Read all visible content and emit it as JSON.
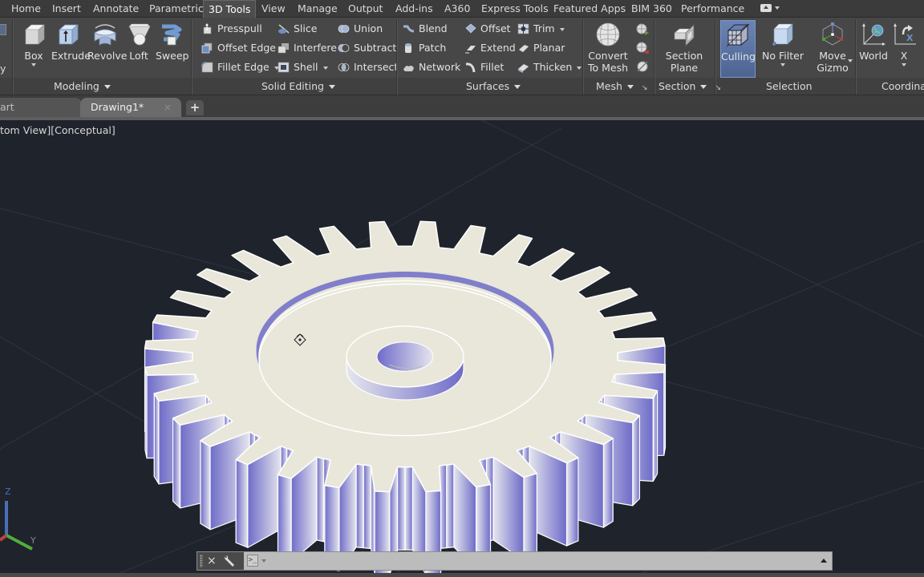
{
  "menu": {
    "tabs": [
      {
        "label": "Home",
        "active": false
      },
      {
        "label": "Insert",
        "active": false
      },
      {
        "label": "Annotate",
        "active": false
      },
      {
        "label": "Parametric",
        "active": false
      },
      {
        "label": "3D Tools",
        "active": true
      },
      {
        "label": "View",
        "active": false
      },
      {
        "label": "Manage",
        "active": false
      },
      {
        "label": "Output",
        "active": false
      },
      {
        "label": "Add-ins",
        "active": false
      },
      {
        "label": "A360",
        "active": false
      },
      {
        "label": "Express Tools",
        "active": false
      },
      {
        "label": "Featured Apps",
        "active": false
      },
      {
        "label": "BIM 360",
        "active": false
      },
      {
        "label": "Performance",
        "active": false
      }
    ]
  },
  "ribbon": {
    "partial_left_label": "y",
    "modeling": {
      "title": "Modeling",
      "buttons": {
        "box": "Box",
        "extrude": "Extrude",
        "revolve": "Revolve",
        "loft": "Loft",
        "sweep": "Sweep"
      }
    },
    "solid_editing": {
      "title": "Solid Editing",
      "buttons": {
        "presspull": "Presspull",
        "offset_edge": "Offset Edge",
        "fillet_edge": "Fillet Edge",
        "slice": "Slice",
        "interfere": "Interfere",
        "shell": "Shell",
        "union": "Union",
        "subtract": "Subtract",
        "intersect": "Intersect"
      }
    },
    "surfaces": {
      "title": "Surfaces",
      "buttons": {
        "blend": "Blend",
        "patch": "Patch",
        "network": "Network",
        "offset": "Offset",
        "extend": "Extend",
        "fillet": "Fillet",
        "trim": "Trim",
        "planar": "Planar",
        "thicken": "Thicken"
      }
    },
    "mesh": {
      "title": "Mesh",
      "convert_line1": "Convert",
      "convert_line2": "To Mesh"
    },
    "section": {
      "title": "Section",
      "plane_line1": "Section",
      "plane_line2": "Plane"
    },
    "selection": {
      "title": "Selection",
      "culling": "Culling",
      "no_filter": "No Filter",
      "gizmo_line1": "Move",
      "gizmo_line2": "Gizmo"
    },
    "coordinates": {
      "title": "Coordinat",
      "world": "World",
      "x": "X"
    }
  },
  "file_tabs": {
    "start_partial": "art",
    "active": "Drawing1*",
    "close_glyph": "×",
    "new_tab_glyph": "+"
  },
  "viewport": {
    "label": "tom View][Conceptual]",
    "ucs": {
      "z": "Z",
      "y": "Y"
    },
    "colors": {
      "background": "#1f232c",
      "face_top": "#e8e7da",
      "face_shade": "#6e6bc8",
      "edge": "#ffffff"
    },
    "gear": {
      "teeth": 32
    }
  },
  "command_line": {
    "close_glyph": "×",
    "prompt_glyph": ">_",
    "input_value": "",
    "placeholder": ""
  }
}
